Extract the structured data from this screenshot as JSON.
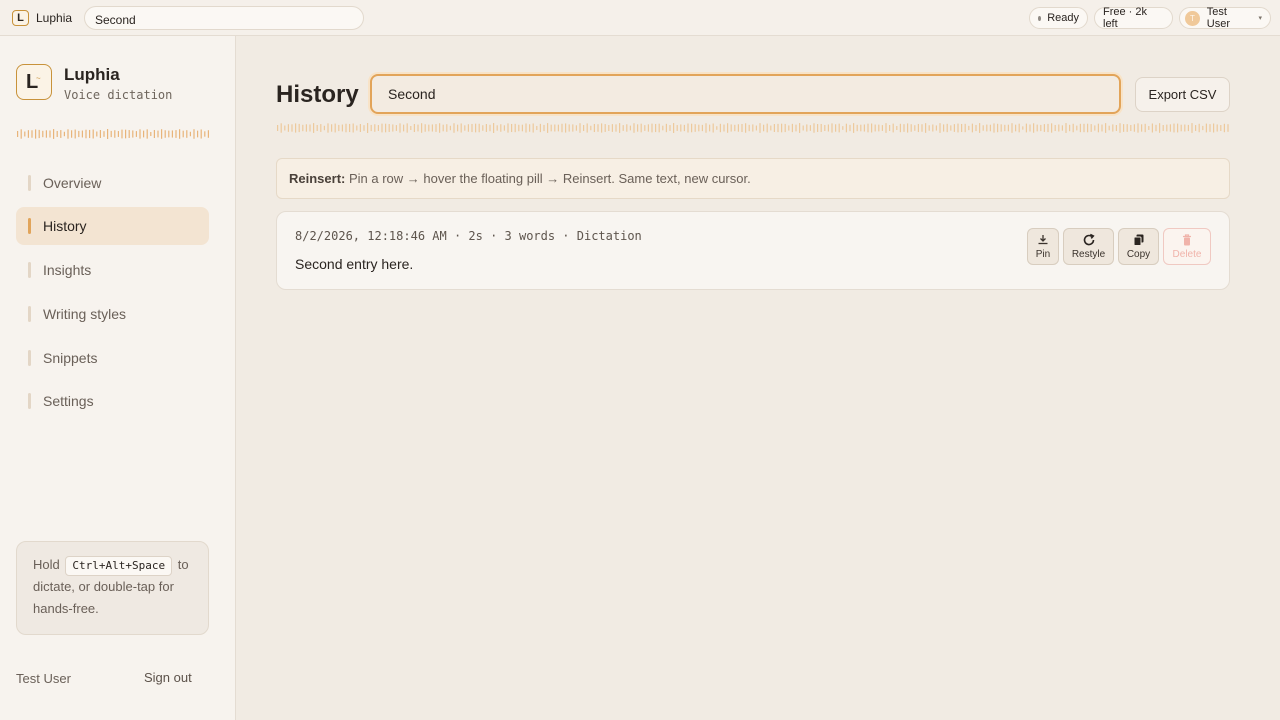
{
  "topbar": {
    "app_name": "Luphia",
    "logo_letter": "L",
    "search_value": "Second",
    "status": "Ready",
    "plan": "Free · 2k left",
    "user_initial": "T",
    "user_name": "Test User"
  },
  "sidebar": {
    "brand_name": "Luphia",
    "brand_subtitle": "Voice dictation",
    "logo_letter": "L",
    "items": [
      {
        "label": "Overview",
        "active": false
      },
      {
        "label": "History",
        "active": true
      },
      {
        "label": "Insights",
        "active": false
      },
      {
        "label": "Writing styles",
        "active": false
      },
      {
        "label": "Snippets",
        "active": false
      },
      {
        "label": "Settings",
        "active": false
      }
    ],
    "hint": {
      "prefix": "Hold",
      "shortcut": "Ctrl+Alt+Space",
      "suffix": "to dictate, or double-tap for hands-free."
    },
    "user_name": "Test User",
    "signout_label": "Sign out"
  },
  "main": {
    "title": "History",
    "search_value": "Second",
    "export_label": "Export CSV",
    "banner": {
      "bold": "Reinsert:",
      "text": "Pin a row → hover the floating pill → Reinsert. Same text, new cursor."
    },
    "entries": [
      {
        "meta": "8/2/2026, 12:18:46 AM · 2s · 3 words · Dictation",
        "text": "Second entry here.",
        "actions": {
          "pin": "Pin",
          "restyle": "Restyle",
          "copy": "Copy",
          "delete": "Delete"
        }
      }
    ]
  },
  "colors": {
    "accent": "#e1a45a",
    "background": "#f1ebe3",
    "sidebar": "#f7f3ee",
    "delete_disabled": "#f0b3aa"
  }
}
